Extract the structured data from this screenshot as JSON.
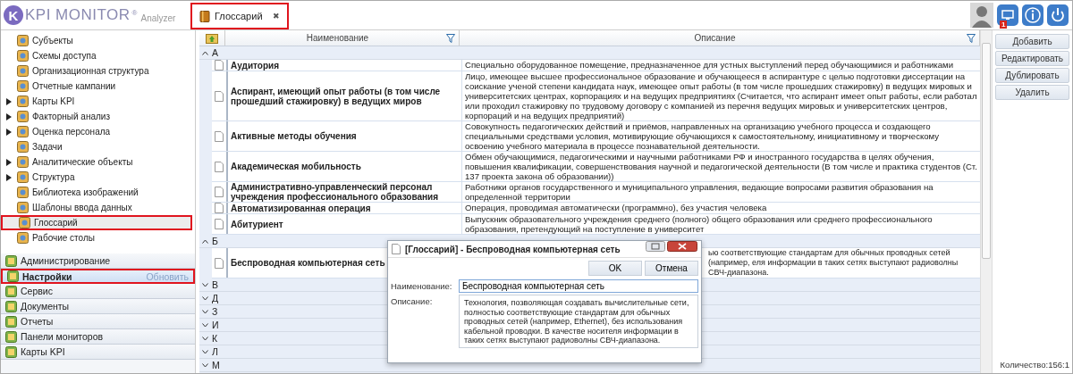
{
  "app": {
    "logo_letter": "K",
    "logo_text": "KPI MONITOR",
    "logo_mark": "®",
    "logo_sub": "Analyzer"
  },
  "tabs": [
    {
      "label": "Глоссарий",
      "close": "✖",
      "selected": true,
      "highlighted": true
    }
  ],
  "notifications": {
    "badge": "1"
  },
  "sidebar": {
    "tree": [
      {
        "label": "Субъекты",
        "has_children": false,
        "selected": false,
        "highlighted": false
      },
      {
        "label": "Схемы доступа",
        "has_children": false,
        "selected": false,
        "highlighted": false
      },
      {
        "label": "Организационная структура",
        "has_children": false,
        "selected": false,
        "highlighted": false
      },
      {
        "label": "Отчетные кампании",
        "has_children": false,
        "selected": false,
        "highlighted": false
      },
      {
        "label": "Карты KPI",
        "has_children": true,
        "selected": false,
        "highlighted": false
      },
      {
        "label": "Факторный анализ",
        "has_children": true,
        "selected": false,
        "highlighted": false
      },
      {
        "label": "Оценка персонала",
        "has_children": true,
        "selected": false,
        "highlighted": false
      },
      {
        "label": "Задачи",
        "has_children": false,
        "selected": false,
        "highlighted": false
      },
      {
        "label": "Аналитические объекты",
        "has_children": true,
        "selected": false,
        "highlighted": false
      },
      {
        "label": "Структура",
        "has_children": true,
        "selected": false,
        "highlighted": false
      },
      {
        "label": "Библиотека изображений",
        "has_children": false,
        "selected": false,
        "highlighted": false
      },
      {
        "label": "Шаблоны ввода данных",
        "has_children": false,
        "selected": false,
        "highlighted": false
      },
      {
        "label": "Глоссарий",
        "has_children": false,
        "selected": true,
        "highlighted": true
      },
      {
        "label": "Рабочие столы",
        "has_children": false,
        "selected": false,
        "highlighted": false
      }
    ],
    "nav": [
      {
        "label": "Администрирование",
        "selected": false,
        "highlighted": false
      },
      {
        "label": "Настройки",
        "selected": true,
        "highlighted": true,
        "action": "Обновить"
      },
      {
        "label": "Сервис",
        "selected": false,
        "highlighted": false
      },
      {
        "label": "Документы",
        "selected": false,
        "highlighted": false
      },
      {
        "label": "Отчеты",
        "selected": false,
        "highlighted": false
      },
      {
        "label": "Панели мониторов",
        "selected": false,
        "highlighted": false
      },
      {
        "label": "Карты KPI",
        "selected": false,
        "highlighted": false
      }
    ]
  },
  "table": {
    "columns": [
      "Наименование",
      "Описание"
    ],
    "groups": [
      {
        "letter": "А",
        "expanded": true,
        "rows": [
          {
            "name": "Аудитория",
            "description": "Специально оборудованное помещение, предназначенное для устных выступлений перед обучающимися и работниками",
            "covered": false
          },
          {
            "name": "Аспирант, имеющий опыт работы (в том числе прошедший стажировку) в ведущих миров",
            "description": "Лицо, имеющее высшее профессиональное образование и обучающееся в аспирантуре с целью подготовки диссертации на соискание ученой степени кандидата наук, имеющее опыт работы (в том числе прошедших стажировку) в ведущих мировых и университетских центрах, корпорациях и на ведущих предприятиях (Считается, что аспирант имеет опыт работы, если работал или проходил стажировку по трудовому договору с компанией из перечня ведущих мировых и университетских центров, корпораций и на ведущих предприятий)",
            "covered": false
          },
          {
            "name": "Активные методы обучения",
            "description": "Совокупность педагогических действий и приёмов, направленных на организацию учебного процесса и создающего специальными средствами условия, мотивирующие обучающихся к самостоятельному, инициативному и творческому освоению учебного материала в процессе познавательной деятельности.",
            "covered": false
          },
          {
            "name": "Академическая мобильность",
            "description": "Обмен обучающимися, педагогическими и научными работниками РФ и иностранного государства в целях обучения, повышения квалификации, совершенствования научной и педагогической деятельности (В том числе и практика студентов (Ст. 137 проекта закона об образовании))",
            "covered": false
          },
          {
            "name": "Административно-управленческий персонал учреждения профессионального образования",
            "description": "Работники органов государственного и муниципального управления, ведающие вопросами развития образования на определенной территории",
            "covered": false
          },
          {
            "name": "Автоматизированная операция",
            "description": "Операция, проводимая автоматически (программно), без участия человека",
            "covered": false
          },
          {
            "name": "Абитуриент",
            "description": "Выпускник образовательного учреждения среднего (полного) общего образования или среднего профессионального образования, претендующий на поступление в университет",
            "covered": false
          }
        ]
      },
      {
        "letter": "Б",
        "expanded": true,
        "rows": [
          {
            "name": "Беспроводная компьютерная сеть",
            "description": "ью соответствующие стандартам для обычных проводных сетей (например, еля информации в таких сетях выступают радиоволны СВЧ-диапазона.",
            "covered": true
          }
        ]
      },
      {
        "letter": "В",
        "expanded": false
      },
      {
        "letter": "Д",
        "expanded": false
      },
      {
        "letter": "З",
        "expanded": false
      },
      {
        "letter": "И",
        "expanded": false
      },
      {
        "letter": "К",
        "expanded": false
      },
      {
        "letter": "Л",
        "expanded": false
      },
      {
        "letter": "М",
        "expanded": false
      }
    ]
  },
  "actions": [
    "Добавить",
    "Редактировать",
    "Дублировать",
    "Удалить"
  ],
  "status": "Количество:156:1",
  "dialog": {
    "title": "[Глоссарий] - Беспроводная компьютерная сеть",
    "buttons": [
      "OK",
      "Отмена"
    ],
    "name_label": "Наименование:",
    "name_value": "Беспроводная компьютерная сеть",
    "description_label": "Описание:",
    "description_value": "Технология, позволяющая создавать вычислительные сети, полностью соответствующие стандартам для обычных проводных сетей (например, Ethernet), без использования кабельной проводки. В качестве носителя информации в таких сетях выступают радиоволны СВЧ-диапазона."
  }
}
